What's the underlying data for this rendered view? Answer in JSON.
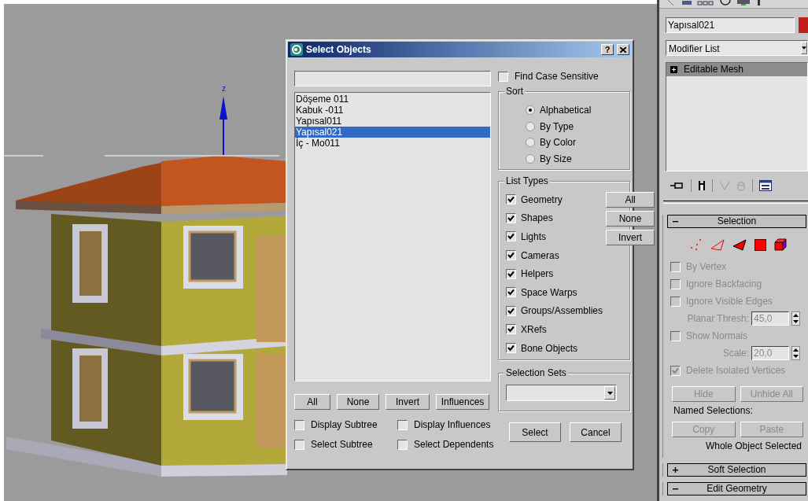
{
  "viewport": {
    "axis_label": "z"
  },
  "dialog": {
    "title": "Select Objects",
    "help": "?",
    "objects": [
      {
        "label": "Döşeme 011",
        "selected": false
      },
      {
        "label": "Kabuk -011",
        "selected": false
      },
      {
        "label": "Yapısal011",
        "selected": false
      },
      {
        "label": "Yapısal021",
        "selected": true
      },
      {
        "label": "İç - Mo011",
        "selected": false
      }
    ],
    "list_buttons": [
      "All",
      "None",
      "Invert",
      "Influences"
    ],
    "options": [
      {
        "label": "Display Subtree",
        "checked": false
      },
      {
        "label": "Display Influences",
        "checked": false
      },
      {
        "label": "Select Subtree",
        "checked": false
      },
      {
        "label": "Select Dependents",
        "checked": false
      }
    ],
    "find_case_sensitive": {
      "label": "Find Case Sensitive",
      "checked": false
    },
    "sort": {
      "title": "Sort",
      "options": [
        {
          "label": "Alphabetical",
          "selected": true
        },
        {
          "label": "By Type",
          "selected": false
        },
        {
          "label": "By Color",
          "selected": false
        },
        {
          "label": "By Size",
          "selected": false
        }
      ]
    },
    "list_types": {
      "title": "List Types",
      "items": [
        {
          "label": "Geometry",
          "checked": true
        },
        {
          "label": "Shapes",
          "checked": true
        },
        {
          "label": "Lights",
          "checked": true
        },
        {
          "label": "Cameras",
          "checked": true
        },
        {
          "label": "Helpers",
          "checked": true
        },
        {
          "label": "Space Warps",
          "checked": true
        },
        {
          "label": "Groups/Assemblies",
          "checked": true
        },
        {
          "label": "XRefs",
          "checked": true
        },
        {
          "label": "Bone Objects",
          "checked": true
        }
      ],
      "buttons": [
        "All",
        "None",
        "Invert"
      ]
    },
    "selection_sets": {
      "title": "Selection Sets"
    },
    "actions": [
      "Select",
      "Cancel"
    ]
  },
  "command_panel": {
    "object_name": "Yapısal021",
    "modifier_list": "Modifier List",
    "stack": [
      {
        "label": "Editable Mesh",
        "selected": true,
        "expanded": false
      }
    ],
    "rollouts": [
      {
        "title": "Selection",
        "expanded": true,
        "items": [
          {
            "kind": "checkbox",
            "label": "By Vertex",
            "checked": false,
            "disabled": true
          },
          {
            "kind": "checkbox",
            "label": "Ignore Backfacing",
            "checked": false,
            "disabled": true
          },
          {
            "kind": "checkbox",
            "label": "Ignore Visible Edges",
            "checked": false,
            "disabled": true
          },
          {
            "kind": "spinner",
            "label": "Planar Thresh:",
            "value": "45,0",
            "disabled": true
          },
          {
            "kind": "checkbox",
            "label": "Show Normals",
            "checked": false,
            "disabled": true
          },
          {
            "kind": "spinner",
            "label": "Scale:",
            "value": "20,0",
            "disabled": true
          },
          {
            "kind": "checkbox",
            "label": "Delete Isolated Vertices",
            "checked": true,
            "disabled": true
          }
        ],
        "buttons": [
          {
            "label": "Hide",
            "disabled": true
          },
          {
            "label": "Unhide All",
            "disabled": true
          }
        ],
        "named_selections": {
          "label": "Named Selections:",
          "buttons": [
            {
              "label": "Copy",
              "disabled": true
            },
            {
              "label": "Paste",
              "disabled": true
            }
          ]
        },
        "status": "Whole Object Selected"
      },
      {
        "title": "Soft Selection",
        "expanded": false
      },
      {
        "title": "Edit Geometry",
        "expanded": true
      }
    ]
  }
}
